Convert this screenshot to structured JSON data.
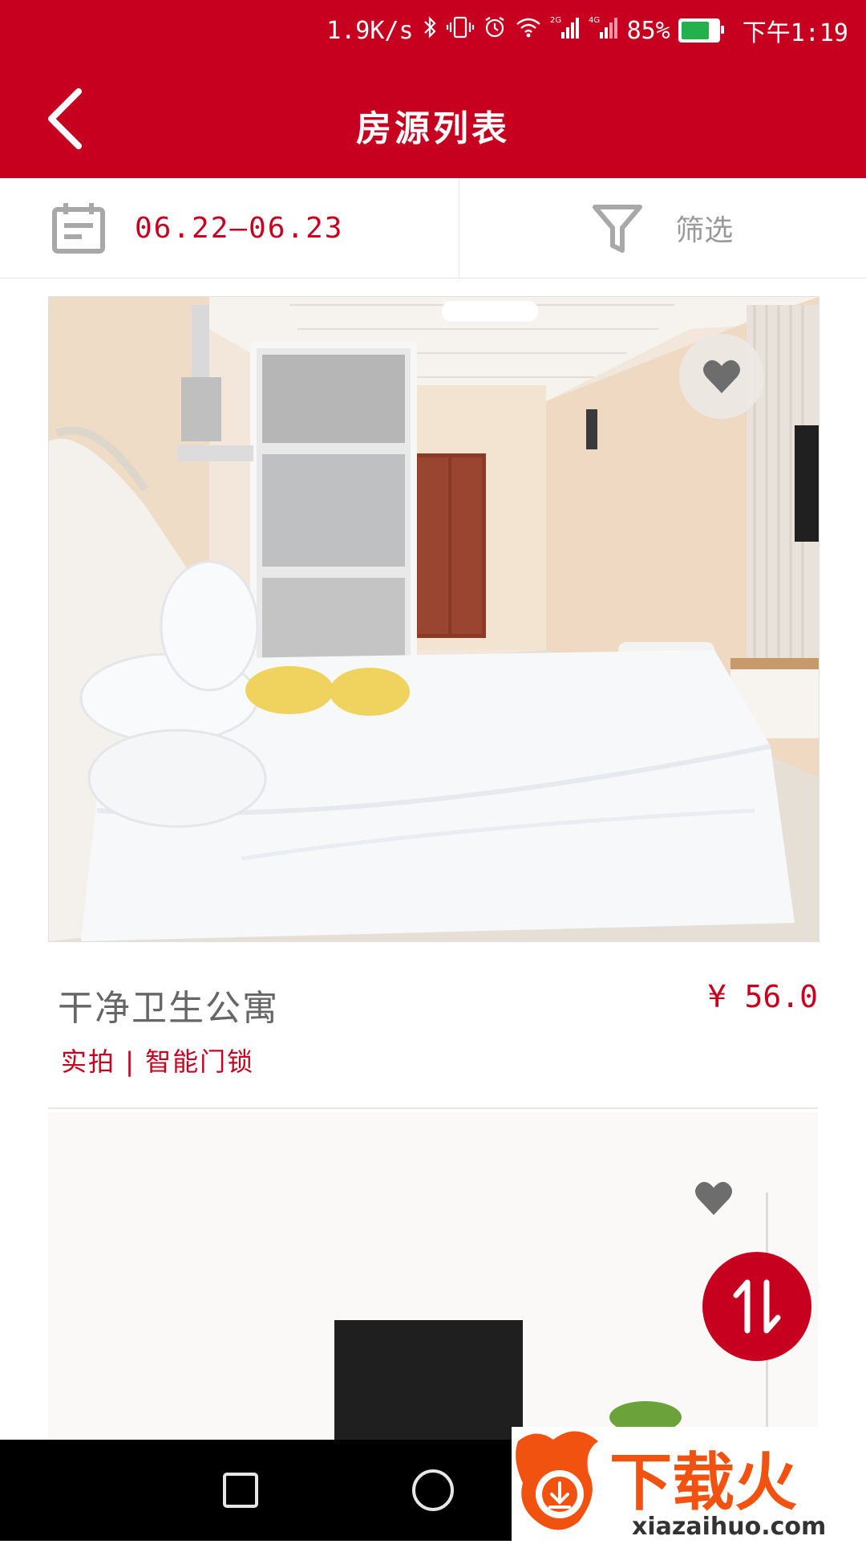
{
  "status_bar": {
    "net_speed": "1.9K/s",
    "battery_percent": "85%",
    "time": "下午1:19",
    "icons": [
      "bluetooth-icon",
      "vibrate-icon",
      "alarm-icon",
      "wifi-icon",
      "signal-2g-icon",
      "signal-4g-icon",
      "battery-charging-icon"
    ],
    "battery_level": 0.85
  },
  "header": {
    "title": "房源列表",
    "back_icon": "back-icon"
  },
  "filter_bar": {
    "date_range": "06.22—06.23",
    "filter_label": "筛选"
  },
  "listings": [
    {
      "title": "干净卫生公寓",
      "price": "¥ 56.0",
      "tags": "实拍 | 智能门锁",
      "favorite": false
    },
    {
      "favorite": false
    }
  ],
  "sort_button": {
    "icon": "sort-swap-icon"
  },
  "nav": [
    "back-triangle-icon",
    "home-circle-icon",
    "recents-square-icon"
  ],
  "watermark": {
    "text": "下载火",
    "url": "xiazaihuo.com"
  },
  "colors": {
    "accent": "#c8001f",
    "gray_text": "#666666"
  }
}
